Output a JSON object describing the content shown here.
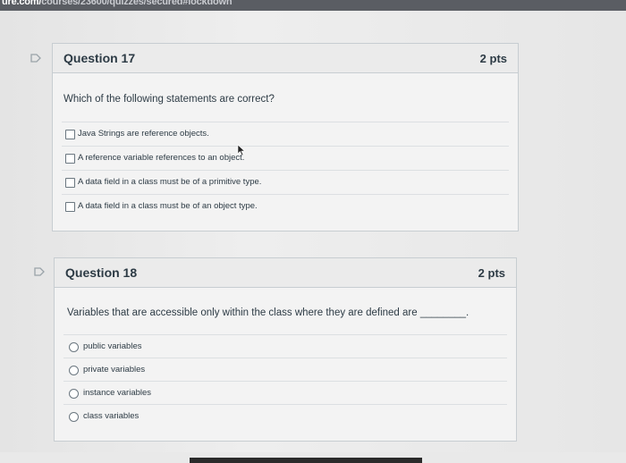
{
  "browser": {
    "url_prefix": "ure.com/",
    "url_rest": "courses/23600/quizzes/secured#lockdown"
  },
  "icons": {
    "flag": "flag-icon",
    "cursor": "mouse-pointer-icon"
  },
  "colors": {
    "text": "#2d3b45",
    "card_bg": "#f3f3f3",
    "header_bg": "#ebebeb",
    "border": "#c7cdd1"
  },
  "questions": [
    {
      "title": "Question 17",
      "points": "2 pts",
      "prompt": "Which of the following statements are correct?",
      "input_type": "checkbox",
      "options": [
        "Java Strings are reference objects.",
        "A reference variable references to an object.",
        "A data field in a class must be of a primitive type.",
        "A data field in a class must be of an object type."
      ]
    },
    {
      "title": "Question 18",
      "points": "2 pts",
      "prompt": "Variables that are accessible only within the class where they are defined are ________.",
      "input_type": "radio",
      "options": [
        "public variables",
        "private variables",
        "instance variables",
        "class variables"
      ]
    }
  ]
}
